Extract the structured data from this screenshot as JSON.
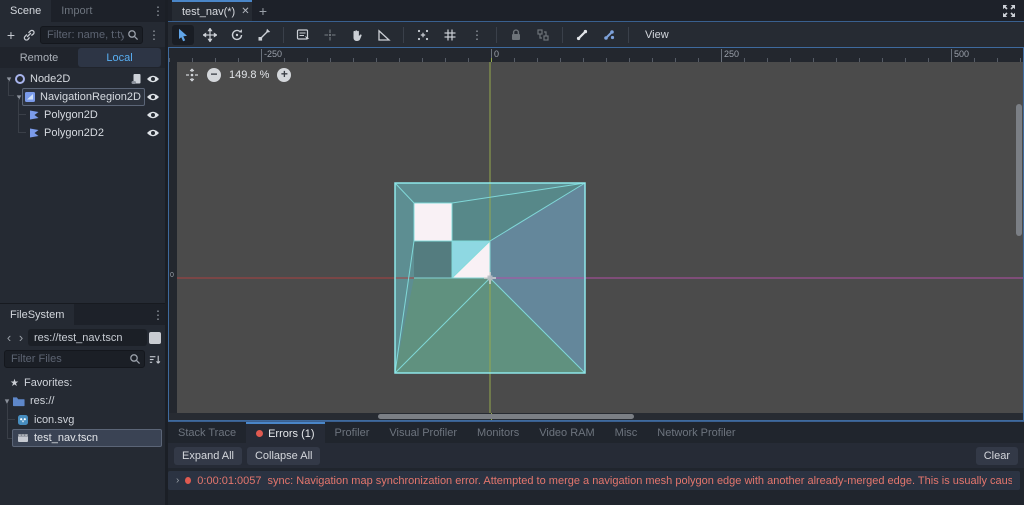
{
  "icons": {
    "dots": "⋮",
    "plus": "+",
    "close": "✕",
    "back": "‹",
    "forward": "›",
    "star": "★",
    "chev_down": "▾",
    "chev_right": "›",
    "zoom_out": "−",
    "zoom_in": "+"
  },
  "scene_dock": {
    "tabs": {
      "scene": "Scene",
      "import": "Import"
    },
    "filter_placeholder": "Filter: name, t:type,",
    "remote_label": "Remote",
    "local_label": "Local",
    "tree": [
      {
        "label": "Node2D"
      },
      {
        "label": "NavigationRegion2D"
      },
      {
        "label": "Polygon2D"
      },
      {
        "label": "Polygon2D2"
      }
    ]
  },
  "filesystem": {
    "title": "FileSystem",
    "path": "res://test_nav.tscn",
    "filter_placeholder": "Filter Files",
    "favorites_label": "Favorites:",
    "root_label": "res://",
    "files": [
      {
        "label": "icon.svg"
      },
      {
        "label": "test_nav.tscn"
      }
    ]
  },
  "editor": {
    "scene_tab_label": "test_nav(*)",
    "view_menu_label": "View",
    "zoom_level": "149.8 %",
    "ruler_labels": [
      "-250",
      "0",
      "250",
      "500"
    ],
    "ruler_zero": "0"
  },
  "bottom_panel": {
    "tabs": [
      "Stack Trace",
      "Errors (1)",
      "Profiler",
      "Visual Profiler",
      "Monitors",
      "Video RAM",
      "Misc",
      "Network Profiler"
    ],
    "expand_all_label": "Expand All",
    "collapse_all_label": "Collapse All",
    "clear_label": "Clear",
    "error_row": {
      "time": "0:00:01:0057",
      "message": "sync: Navigation map synchronization error. Attempted to merge a navigation mesh polygon edge with another already-merged edge. This is usually caused by crossing edges, ov..."
    }
  },
  "colors": {
    "accent_blue": "#4a86c8",
    "selected_text_blue": "#58aef2",
    "error_salmon": "#e4766d",
    "axis_x_red": "#aa4040",
    "axis_x_magenta": "#b04fa5",
    "axis_y_green": "#96a94e",
    "mesh_outline": "#8ee8ea",
    "canvas_gray": "#4b4b4b"
  }
}
